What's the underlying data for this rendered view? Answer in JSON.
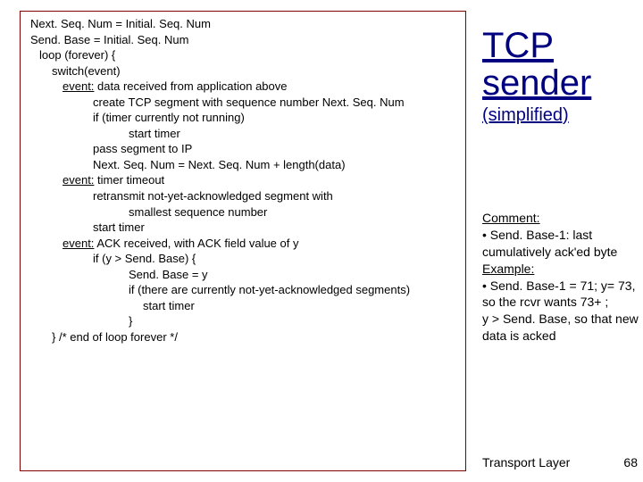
{
  "code": {
    "l1": "Next. Seq. Num = Initial. Seq. Num",
    "l2": "Send. Base = Initial. Seq. Num",
    "l3": "loop (forever) {",
    "l4": "switch(event)",
    "e1": "event:",
    "e1t": " data received from application above",
    "l5": "create TCP segment with sequence number Next. Seq. Num",
    "l6": "if (timer currently not running)",
    "l7": "start timer",
    "l8": "pass segment to IP",
    "l9": "Next. Seq. Num = Next. Seq. Num + length(data)",
    "e2": "event:",
    "e2t": " timer timeout",
    "l10": "retransmit not-yet-acknowledged segment with",
    "l11": "smallest sequence number",
    "l12": "start timer",
    "e3": "event:",
    "e3t": " ACK received, with ACK field value of y",
    "l13": "if (y > Send. Base) {",
    "l14": "Send. Base = y",
    "l15": "if (there are currently not-yet-acknowledged segments)",
    "l16": "start timer",
    "l17": "}",
    "l18": "}  /* end of loop forever */"
  },
  "title": {
    "line1": "TCP",
    "line2": "sender",
    "sub": "(simplified)"
  },
  "comment": {
    "h1": "Comment:",
    "b1": " • Send. Base-1: last cumulatively ack'ed byte",
    "h2": "Example:",
    "b2": " • Send. Base-1 = 71; y= 73, so the rcvr wants 73+ ;",
    "b3": "y > Send. Base, so that new data is acked"
  },
  "footer": {
    "label": "Transport Layer",
    "page": "68"
  }
}
